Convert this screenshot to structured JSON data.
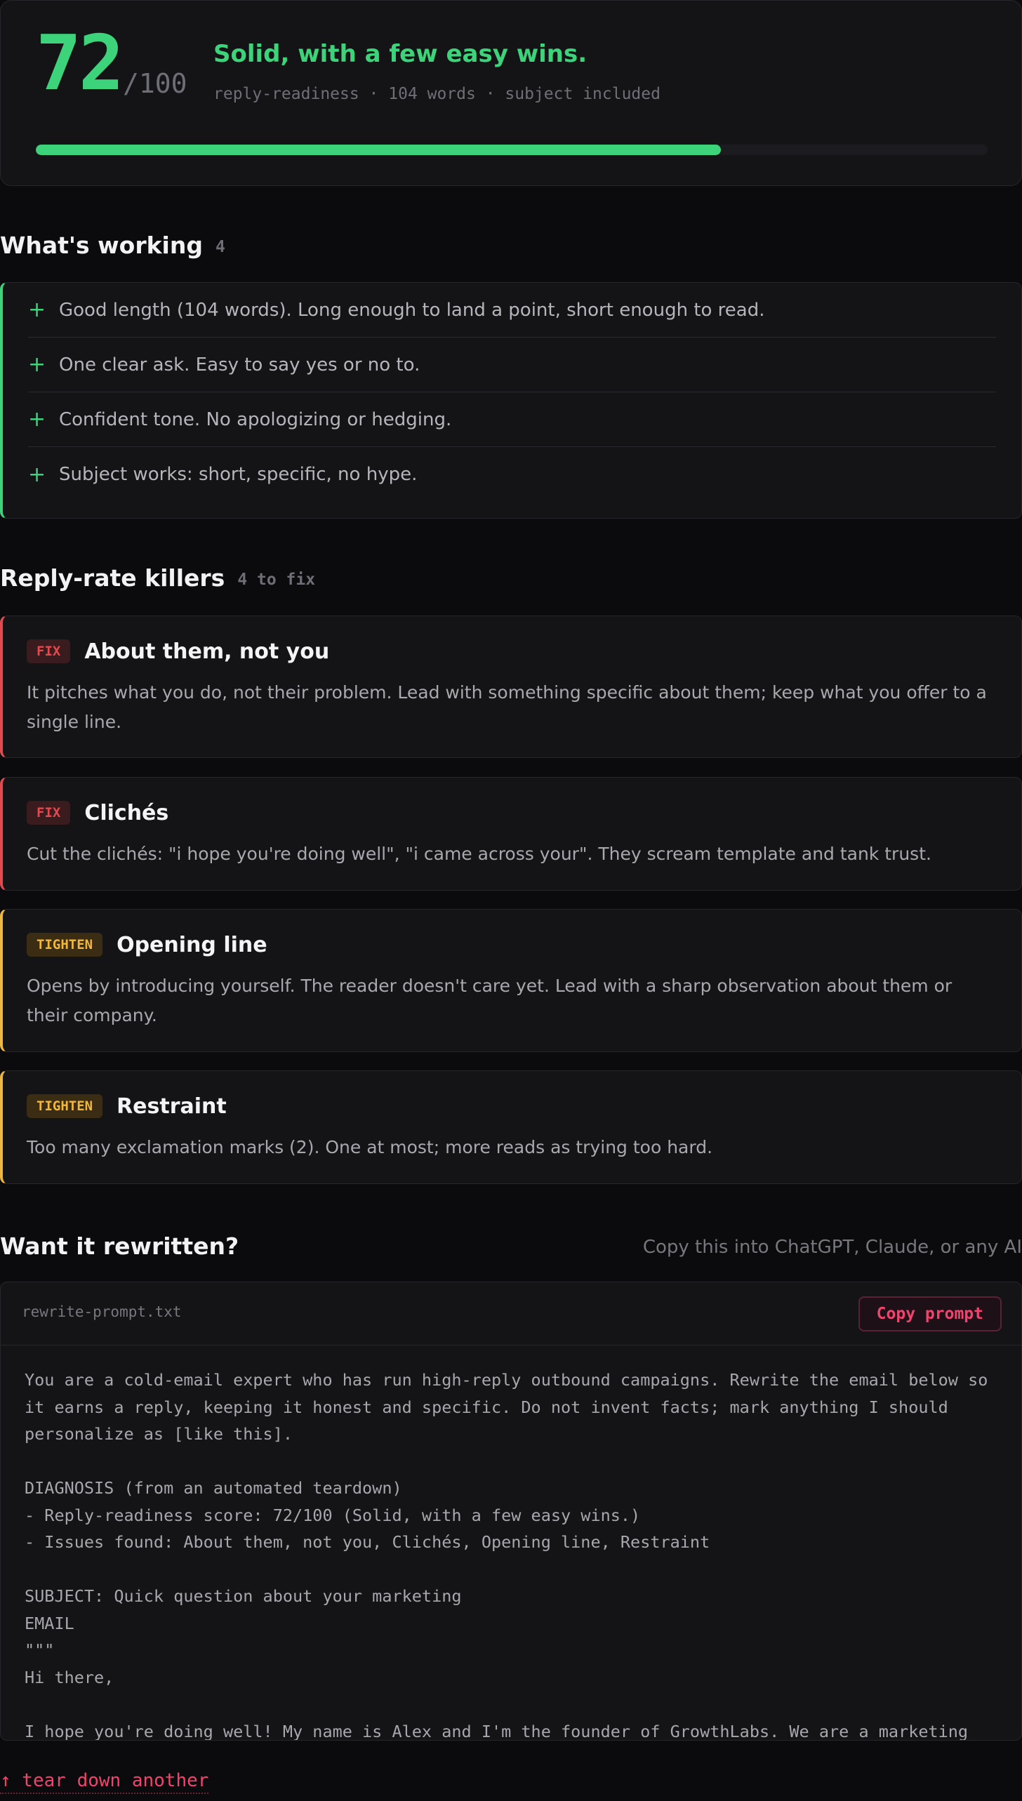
{
  "score": {
    "value": "72",
    "max": "/100",
    "progress_percent": 72,
    "verdict": "Solid, with a few easy wins.",
    "meta": "reply-readiness · 104 words · subject included"
  },
  "working": {
    "title": "What's working",
    "count": "4",
    "items": [
      "Good length (104 words). Long enough to land a point, short enough to read.",
      "One clear ask. Easy to say yes or no to.",
      "Confident tone. No apologizing or hedging.",
      "Subject works: short, specific, no hype."
    ],
    "marker": "+"
  },
  "killers": {
    "title": "Reply-rate killers",
    "count": "4 to fix",
    "issues": [
      {
        "badge": "FIX",
        "title": "About them, not you",
        "body": "It pitches what you do, not their problem. Lead with something specific about them; keep what you offer to a single line."
      },
      {
        "badge": "FIX",
        "title": "Clichés",
        "body": "Cut the clichés: \"i hope you're doing well\", \"i came across your\". They scream template and tank trust."
      },
      {
        "badge": "TIGHTEN",
        "title": "Opening line",
        "body": "Opens by introducing yourself. The reader doesn't care yet. Lead with a sharp observation about them or their company."
      },
      {
        "badge": "TIGHTEN",
        "title": "Restraint",
        "body": "Too many exclamation marks (2). One at most; more reads as trying too hard."
      }
    ]
  },
  "rewrite": {
    "title": "Want it rewritten?",
    "hint": "Copy this into ChatGPT, Claude, or any AI",
    "file_name": "rewrite-prompt.txt",
    "copy_label": "Copy prompt",
    "prompt": "You are a cold-email expert who has run high-reply outbound campaigns. Rewrite the email below so it earns a reply, keeping it honest and specific. Do not invent facts; mark anything I should personalize as [like this].\n\nDIAGNOSIS (from an automated teardown)\n- Reply-readiness score: 72/100 (Solid, with a few easy wins.)\n- Issues found: About them, not you, Clichés, Opening line, Restraint\n\nSUBJECT: Quick question about your marketing\nEMAIL\n\"\"\"\nHi there,\n\nI hope you're doing well! My name is Alex and I'm the founder of GrowthLabs. We are a marketing"
  },
  "footer": {
    "link": "↑ tear down another"
  },
  "colors": {
    "good": "#3dd37a",
    "fix": "#e5484d",
    "tighten": "#f1b73c",
    "accent": "#f0436e"
  }
}
